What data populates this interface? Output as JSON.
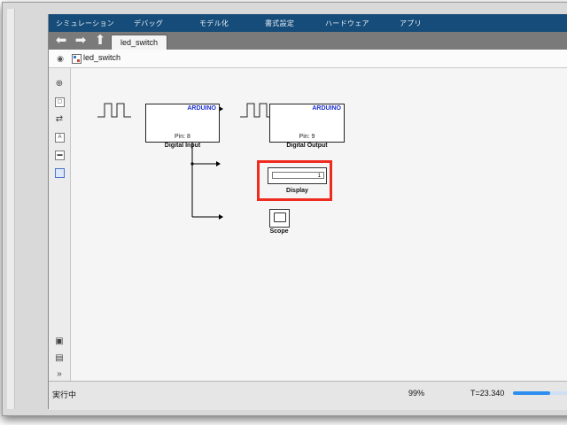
{
  "menu": {
    "items": [
      "シミュレーション",
      "デバッグ",
      "モデル化",
      "書式設定",
      "ハードウェア",
      "アプリ"
    ]
  },
  "nav": {
    "tab_label": "led_switch",
    "icons": [
      "back-arrow-icon",
      "forward-arrow-icon",
      "up-arrow-icon"
    ]
  },
  "breadcrumb": {
    "label": "led_switch"
  },
  "blocks": {
    "digital_input": {
      "tag": "ARDUINO",
      "pin": "Pin: 8",
      "caption": "Digital Input"
    },
    "digital_output": {
      "tag": "ARDUINO",
      "pin": "Pin: 9",
      "caption": "Digital Output"
    },
    "display": {
      "value": "1",
      "caption": "Display"
    },
    "scope": {
      "caption": "Scope"
    }
  },
  "status": {
    "state": "実行中",
    "zoom": "99%",
    "time": "T=23.340",
    "progress": 0.55
  },
  "colors": {
    "menubar": "#154c79",
    "highlight": "#ee2b1e",
    "arduino_tag": "#1d2fcf",
    "progress": "#2e8ef0"
  }
}
